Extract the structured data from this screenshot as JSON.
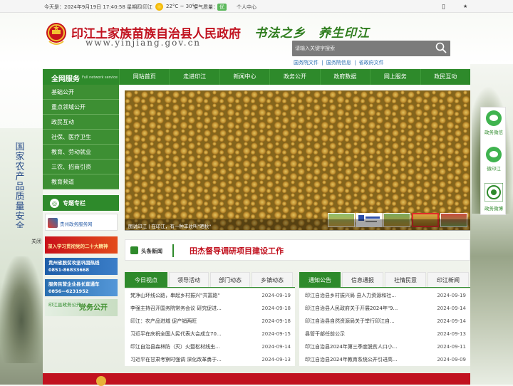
{
  "topbar": {
    "date": "今天是：2024年9月19日 17:40:58 星期四",
    "location": "印江",
    "temperature": "22°C ~ 30°C",
    "air_quality_label": "空气质量：",
    "air_quality_value": "优",
    "user_center": "个人中心"
  },
  "header": {
    "title": "印江土家族苗族自治县人民政府",
    "url": "www.yinjiang.gov.cn",
    "slogan_1": "书法之乡",
    "slogan_2": "养生印江"
  },
  "search": {
    "placeholder": "请输入关键字搜索",
    "links": [
      "国务院文件",
      "|",
      "国务院信息",
      "|",
      "省政府文件"
    ]
  },
  "nav": {
    "left_title": "全网服务",
    "left_subtitle": "Full network service",
    "items": [
      "网站首页",
      "走进印江",
      "新闻中心",
      "政务公开",
      "政府数据",
      "网上服务",
      "政民互动"
    ]
  },
  "side_menu": [
    "基础公开",
    "重点领域公开",
    "政民互动",
    "社保、医疗卫生",
    "教育、劳动就业",
    "三农、招商引资",
    "教育频道"
  ],
  "special": {
    "title": "专题专栏",
    "banners": [
      "贵州政务服务网",
      "深入学习贯彻党的二十大精神",
      "贵州省脱贫攻坚巩固热线",
      "0851-86833668",
      "服务民营企业县长直通车",
      "0856—6231952",
      "印江县政务公开",
      "党务公开"
    ]
  },
  "side_strip_text": "国家农产品质量安全县",
  "close_label": "关闭",
  "carousel": {
    "caption": "图说印江 | 在印江，有一种丰收叫\"晒秋\""
  },
  "headline": {
    "label": "头条新闻",
    "title": "田杰督导调研项目建设工作"
  },
  "news_left": {
    "tabs": [
      "今日视点",
      "领导活动",
      "部门动态",
      "乡镇动态"
    ],
    "rows": [
      {
        "title": "梵净山环线公路，串起乡村振兴\"共富路\"",
        "date": "2024-09-19"
      },
      {
        "title": "李强主持召开国务院常务会议 研究促进...",
        "date": "2024-09-18"
      },
      {
        "title": "印江：农产品进城 促产销两旺",
        "date": "2024-09-18"
      },
      {
        "title": "习近平在庆祝全国人民代表大会成立70...",
        "date": "2024-09-15"
      },
      {
        "title": "印江自治县森林防（灭）火暨松材线虫...",
        "date": "2024-09-14"
      },
      {
        "title": "习近平在甘肃考察时强调 深化改革勇于...",
        "date": "2024-09-13"
      }
    ]
  },
  "news_right": {
    "tabs": [
      "通知公告",
      "信息通报",
      "社情民意",
      "印江新闻"
    ],
    "rows": [
      {
        "title": "印江自治县乡村振兴局 县人力资源和社...",
        "date": "2024-09-19"
      },
      {
        "title": "印江自治县人民政府关于开展2024年\"9...",
        "date": "2024-09-14"
      },
      {
        "title": "印江自治县自然资源局关于举行印江自...",
        "date": "2024-09-14"
      },
      {
        "title": "县管干部任前公示",
        "date": "2024-09-13"
      },
      {
        "title": "印江自治县2024年第三季度脱贫人口小...",
        "date": "2024-09-11"
      },
      {
        "title": "印江自治县2024年教育系统公开引进高...",
        "date": "2024-09-09"
      }
    ]
  },
  "float_right": [
    "政务微信",
    "微印江",
    "政务微博"
  ],
  "colors": {
    "brand_green": "#2e8a2b",
    "title_red": "#c1121f"
  }
}
